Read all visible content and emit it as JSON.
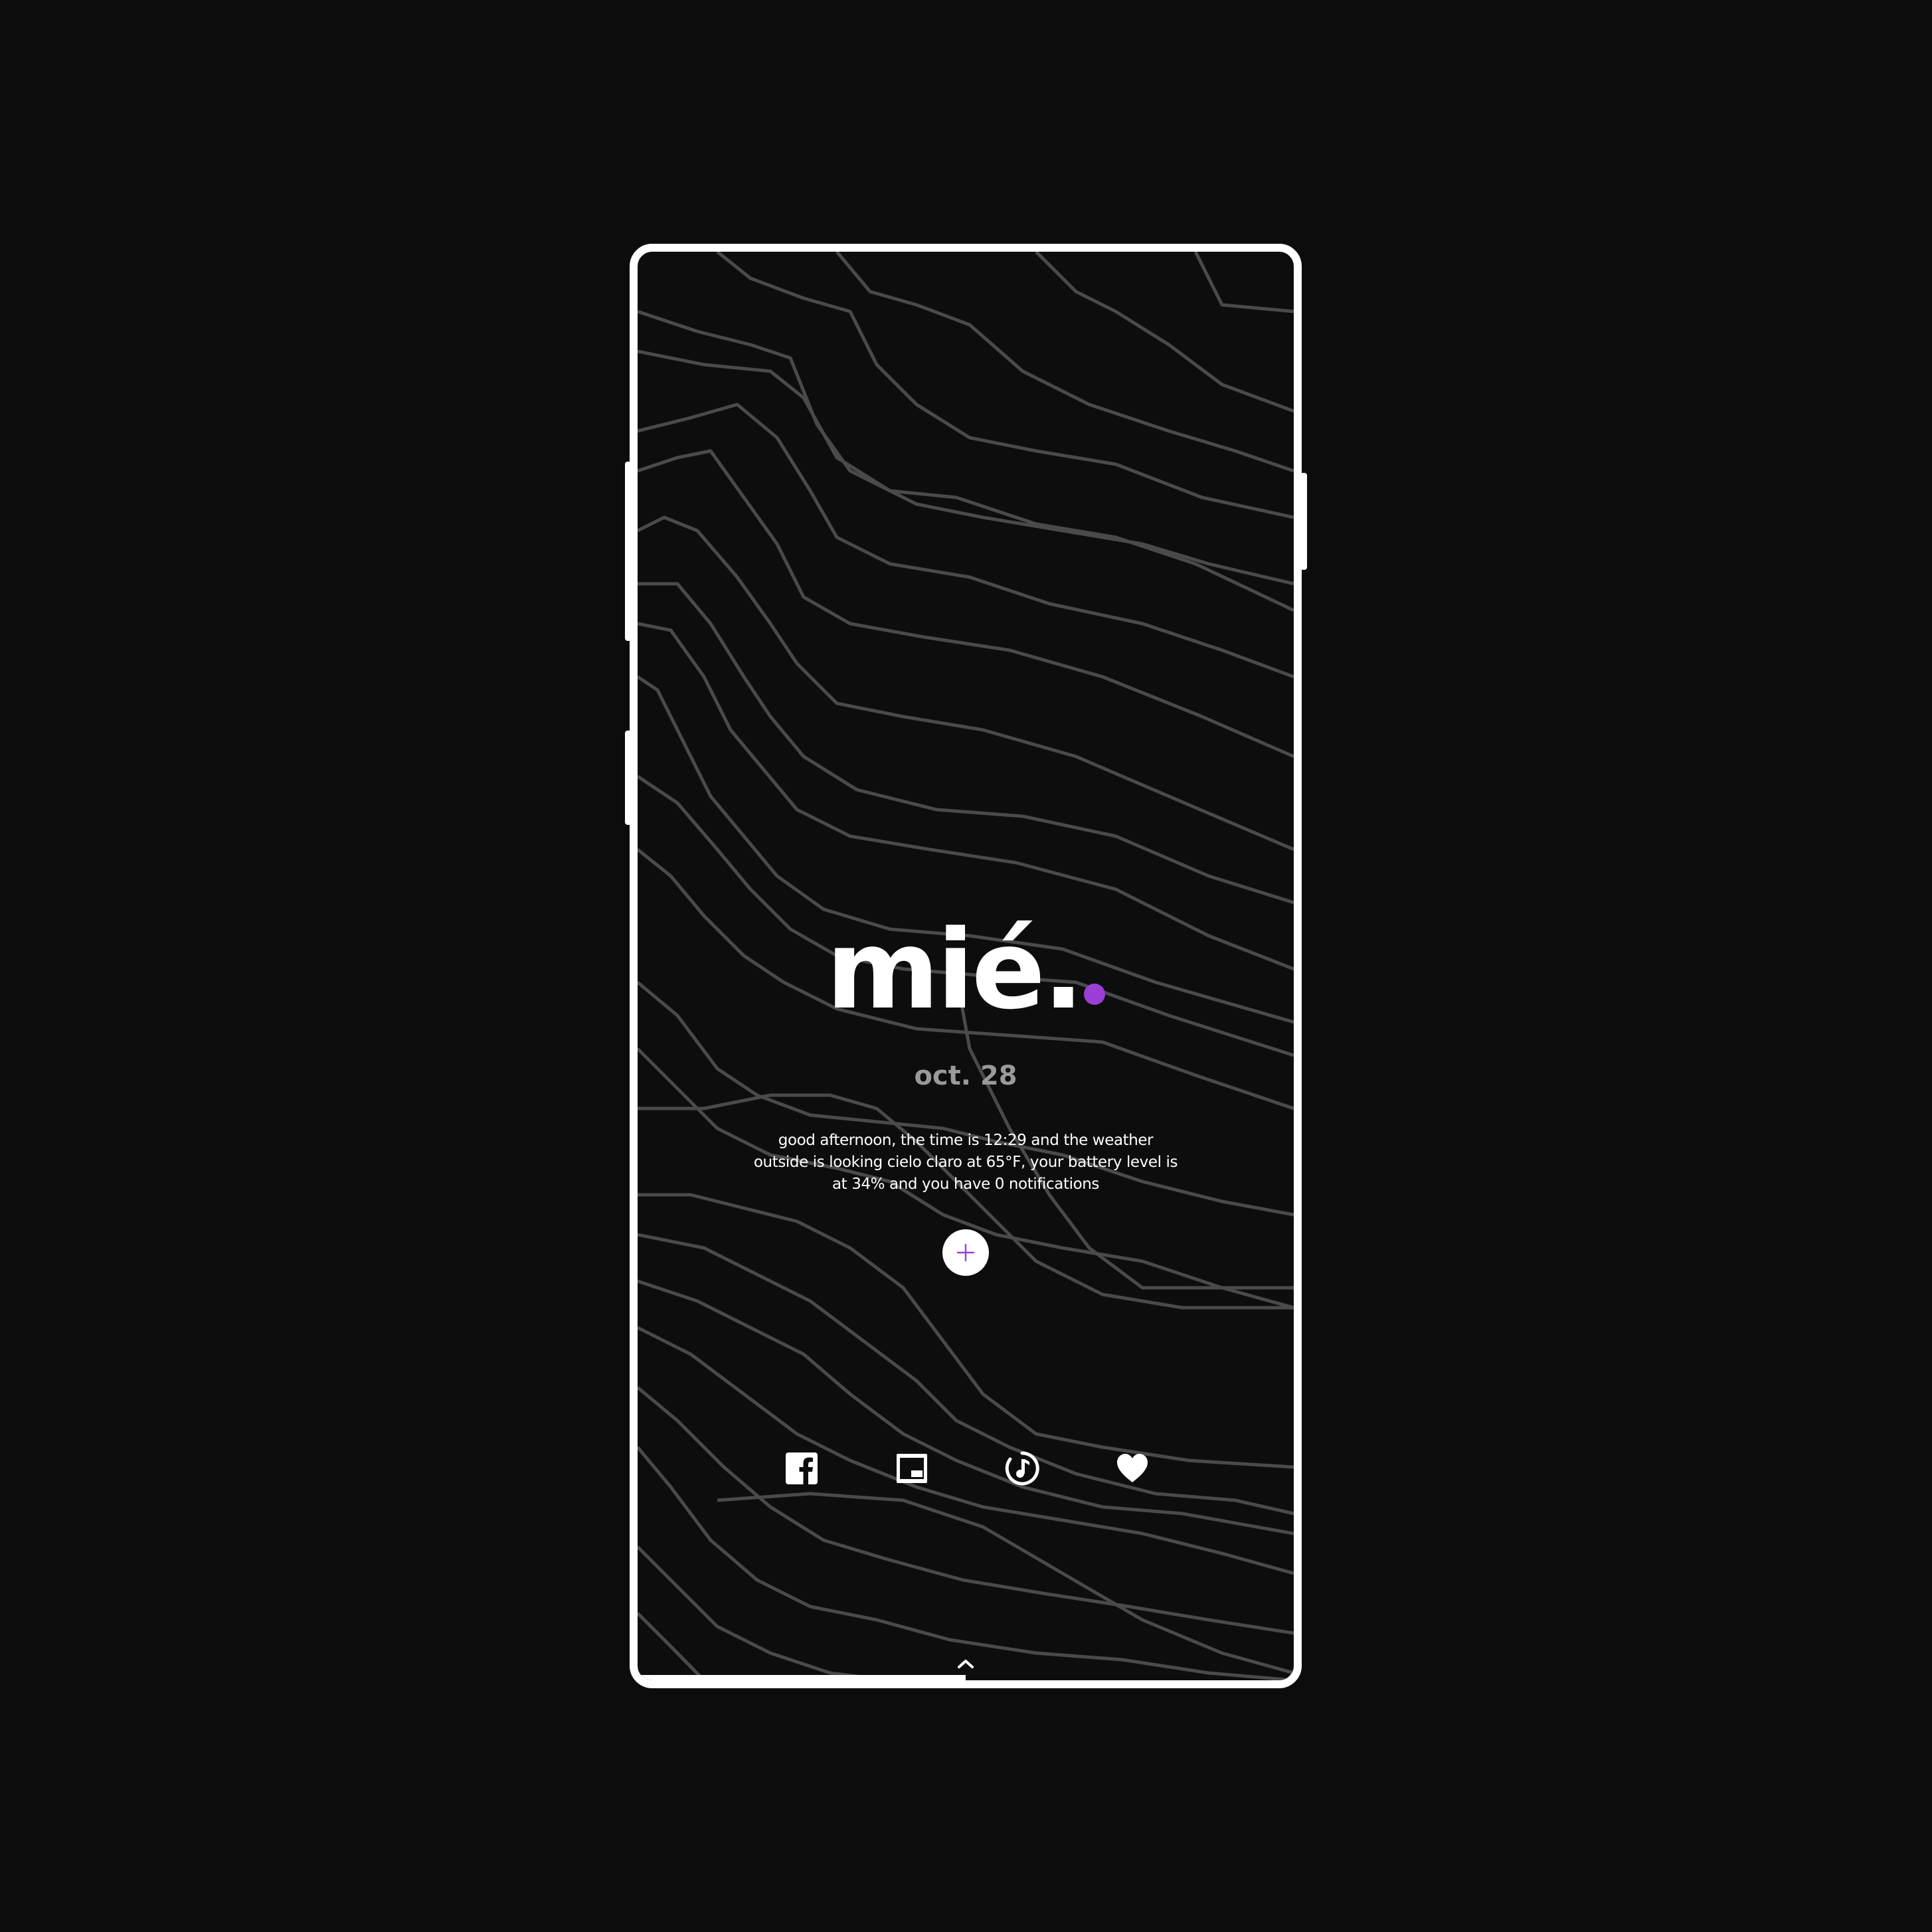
{
  "lockscreen": {
    "day_label": "mié.",
    "date_label": "oct. 28",
    "summary_text": "good afternoon, the time is 12:29 and the weather outside is looking cielo claro at 65°F, your battery level is at 34% and you have 0 notifications",
    "add_button_symbol": "+"
  },
  "dock": {
    "items": [
      {
        "icon": "facebook-icon"
      },
      {
        "icon": "tv-icon"
      },
      {
        "icon": "music-icon"
      },
      {
        "icon": "heart-icon"
      }
    ]
  },
  "colors": {
    "accent": "#9b3fd6",
    "background": "#0d0d0d",
    "line": "#4a4a4a",
    "text": "#ffffff",
    "muted": "#9a9a9a"
  }
}
